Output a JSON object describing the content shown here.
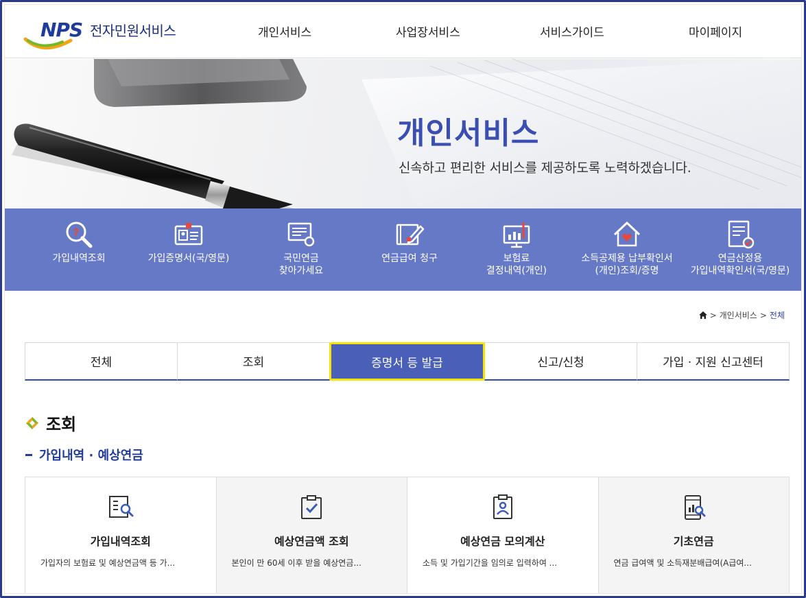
{
  "header": {
    "logo_mark": "NPS",
    "logo_text": "전자민원서비스",
    "nav": [
      "개인서비스",
      "사업장서비스",
      "서비스가이드",
      "마이페이지"
    ]
  },
  "hero": {
    "title": "개인서비스",
    "subtitle": "신속하고 편리한 서비스를 제공하도록 노력하겠습니다."
  },
  "quick_menu": [
    {
      "label_1": "가입내역조회",
      "label_2": "",
      "icon": "search-question-icon"
    },
    {
      "label_1": "가입증명서(국/영문)",
      "label_2": "",
      "icon": "id-card-icon"
    },
    {
      "label_1": "국민연금",
      "label_2": "찾아가세요",
      "icon": "monitor-search-icon"
    },
    {
      "label_1": "연금급여 청구",
      "label_2": "",
      "icon": "document-pen-icon"
    },
    {
      "label_1": "보험료",
      "label_2": "결정내역(개인)",
      "icon": "chart-monitor-icon"
    },
    {
      "label_1": "소득공제용 납부확인서",
      "label_2": "(개인)조회/증명",
      "icon": "house-heart-icon"
    },
    {
      "label_1": "연금산정용",
      "label_2": "가입내역확인서(국/영문)",
      "icon": "document-check-icon"
    }
  ],
  "breadcrumb": {
    "level1": "개인서비스",
    "current": "전체"
  },
  "tabs": [
    "전체",
    "조회",
    "증명서 등 발급",
    "신고/신청",
    "가입 · 지원 신고센터"
  ],
  "active_tab": "증명서 등 발급",
  "section": {
    "title": "조회",
    "subtitle": "가입내역 · 예상연금"
  },
  "cards": [
    {
      "title": "가입내역조회",
      "desc": "가입자의 보험료 및 예상연금액 등 가...",
      "icon": "list-search-icon"
    },
    {
      "title": "예상연금액 조회",
      "desc": "본인이 만 60세 이후 받을 예상연금...",
      "icon": "clipboard-check-icon"
    },
    {
      "title": "예상연금 모의계산",
      "desc": "소득 및 가입기간을 임의로 입력하여 ...",
      "icon": "clipboard-person-icon"
    },
    {
      "title": "기초연금",
      "desc": "연금 급여액 및 소득재분배급여(A급여...",
      "icon": "phone-chart-icon"
    }
  ],
  "colors": {
    "brand": "#1f3b9b",
    "accent": "#4a60b8",
    "strip": "#6679c6",
    "highlight": "#f4e400"
  }
}
